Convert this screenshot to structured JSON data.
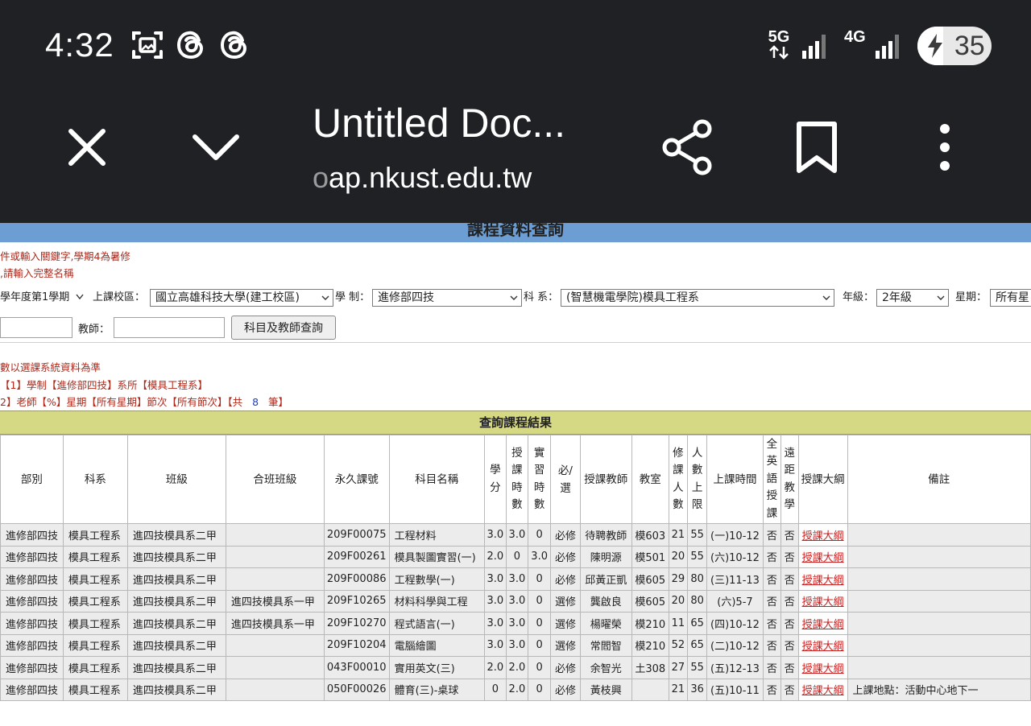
{
  "status_bar": {
    "time": "4:32",
    "icons": [
      "screen-record-icon",
      "threads-icon",
      "threads-icon"
    ],
    "network_1": "5G",
    "network_2": "4G",
    "battery": "35",
    "battery_level": 0.35
  },
  "browser": {
    "title": "Untitled Doc...",
    "url_faded": "o",
    "url": "ap.nkust.edu.tw"
  },
  "page": {
    "header": "課程資料查詢",
    "notice_1": "件或輸入關鍵字,學期4為暑修",
    "notice_2": ",請輸入完整名稱",
    "filters": {
      "term": "學年度第1學期",
      "campus_label": "上課校區：",
      "campus": "國立高雄科技大學(建工校區)",
      "system_label": "學 制：",
      "system": "進修部四技",
      "dept_label": "科 系：",
      "dept": "(智慧機電學院)模具工程系",
      "grade_label": "年級：",
      "grade": "2年級",
      "weekday_label": "星期：",
      "weekday": "所有星"
    },
    "teacher_label": "教師：",
    "query_button": "科目及教師查詢",
    "info_1": "數以選課系統資料為準",
    "info_2": "【1】學制【進修部四技】系所【模具工程系】",
    "info_3a": "2】老師【%】星期【所有星期】節次【所有節次】【共",
    "info_3b": "8",
    "info_3c": "筆】",
    "result_title": "查詢課程結果"
  },
  "table": {
    "headers": [
      "部別",
      "科系",
      "班級",
      "合班班級",
      "永久課號",
      "科目名稱",
      "學分",
      "授課時數",
      "實習時數",
      "必/選",
      "授課教師",
      "教室",
      "修課人數",
      "人數上限",
      "上課時間",
      "全英語授課",
      "遠距教學",
      "授課大綱",
      "備註"
    ],
    "rows": [
      [
        "進修部四技",
        "模具工程系",
        "進四技模具系二甲",
        "",
        "209F00075",
        "工程材料",
        "3.0",
        "3.0",
        "0",
        "必修",
        "待聘教師",
        "模603",
        "21",
        "55",
        "(一)10-12",
        "否",
        "否",
        "授課大綱",
        ""
      ],
      [
        "進修部四技",
        "模具工程系",
        "進四技模具系二甲",
        "",
        "209F00261",
        "模具製圖實習(一)",
        "2.0",
        "0",
        "3.0",
        "必修",
        "陳明源",
        "模501",
        "20",
        "55",
        "(六)10-12",
        "否",
        "否",
        "授課大綱",
        ""
      ],
      [
        "進修部四技",
        "模具工程系",
        "進四技模具系二甲",
        "",
        "209F00086",
        "工程數學(一)",
        "3.0",
        "3.0",
        "0",
        "必修",
        "邱黃正凱",
        "模605",
        "29",
        "80",
        "(三)11-13",
        "否",
        "否",
        "授課大綱",
        ""
      ],
      [
        "進修部四技",
        "模具工程系",
        "進四技模具系二甲",
        "進四技模具系一甲",
        "209F10265",
        "材料科學與工程",
        "3.0",
        "3.0",
        "0",
        "選修",
        "龔啟良",
        "模605",
        "20",
        "80",
        "(六)5-7",
        "否",
        "否",
        "授課大綱",
        ""
      ],
      [
        "進修部四技",
        "模具工程系",
        "進四技模具系二甲",
        "進四技模具系一甲",
        "209F10270",
        "程式語言(一)",
        "3.0",
        "3.0",
        "0",
        "選修",
        "楊曜榮",
        "模210",
        "11",
        "65",
        "(四)10-12",
        "否",
        "否",
        "授課大綱",
        ""
      ],
      [
        "進修部四技",
        "模具工程系",
        "進四技模具系二甲",
        "",
        "209F10204",
        "電腦繪圖",
        "3.0",
        "3.0",
        "0",
        "選修",
        "常閻智",
        "模210",
        "52",
        "65",
        "(二)10-12",
        "否",
        "否",
        "授課大綱",
        ""
      ],
      [
        "進修部四技",
        "模具工程系",
        "進四技模具系二甲",
        "",
        "043F00010",
        "實用英文(三)",
        "2.0",
        "2.0",
        "0",
        "必修",
        "余智光",
        "土308",
        "27",
        "55",
        "(五)12-13",
        "否",
        "否",
        "授課大綱",
        ""
      ],
      [
        "進修部四技",
        "模具工程系",
        "進四技模具系二甲",
        "",
        "050F00026",
        "體育(三)-桌球",
        "0",
        "2.0",
        "0",
        "必修",
        "黃枝興",
        "",
        "21",
        "36",
        "(五)10-11",
        "否",
        "否",
        "授課大綱",
        "上課地點：活動中心地下一"
      ]
    ]
  }
}
